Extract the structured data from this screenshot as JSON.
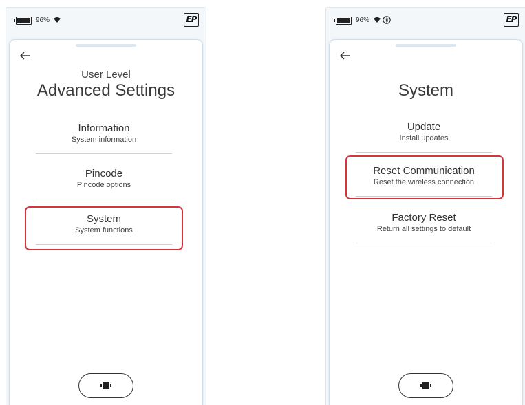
{
  "left_screen": {
    "status": {
      "battery_pct": "96%",
      "battery_level": 0.96
    },
    "logo": "EP",
    "subtitle": "User Level",
    "title": "Advanced Settings",
    "items": [
      {
        "label": "Information",
        "desc": "System information"
      },
      {
        "label": "Pincode",
        "desc": "Pincode options"
      },
      {
        "label": "System",
        "desc": "System functions"
      }
    ],
    "highlighted_item": "System"
  },
  "right_screen": {
    "status": {
      "battery_pct": "96%",
      "battery_level": 0.96
    },
    "logo": "EP",
    "title": "System",
    "items": [
      {
        "label": "Update",
        "desc": "Install updates"
      },
      {
        "label": "Reset Communication",
        "desc": "Reset the wireless connection"
      },
      {
        "label": "Factory Reset",
        "desc": "Return all settings to default"
      }
    ],
    "highlighted_item": "Reset Communication"
  },
  "icons": {
    "back": "left-arrow-icon",
    "wifi": "wifi-icon",
    "bluetooth": "bluetooth-icon",
    "battery": "battery-icon",
    "home": "cube-icon"
  },
  "colors": {
    "highlight": "#d6343b",
    "screen_border": "#cfe0ec",
    "divider": "#cfcfcf"
  }
}
